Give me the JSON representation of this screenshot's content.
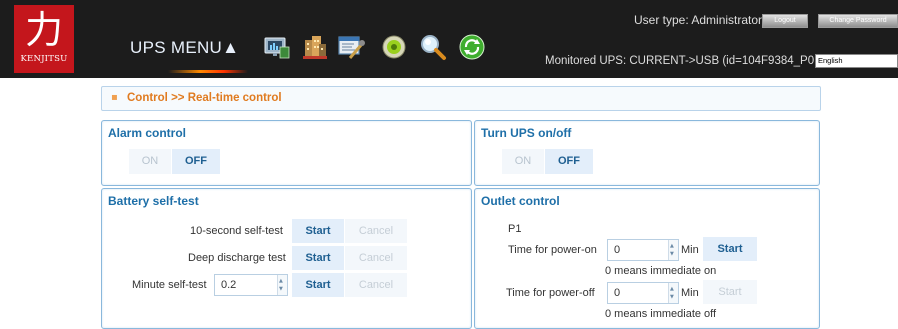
{
  "header": {
    "logo_glyph": "力",
    "logo_text": "KENJITSU",
    "menu_label": "UPS MENU▲",
    "user_type": "User type: Administrator",
    "logout_label": "Logout",
    "change_password_label": "Change Password",
    "monitored_ups": "Monitored UPS: CURRENT->USB (id=104F9384_P01)",
    "language": "English",
    "toolbar_icons": [
      "monitor-chart-icon",
      "buildings-icon",
      "settings-tools-icon",
      "power-disc-icon",
      "search-icon",
      "refresh-icon"
    ]
  },
  "breadcrumb": {
    "bullet": "▪",
    "text": "Control >> Real-time control"
  },
  "alarm_control": {
    "title": "Alarm control",
    "on_label": "ON",
    "off_label": "OFF"
  },
  "ups_onoff": {
    "title": "Turn UPS on/off",
    "on_label": "ON",
    "off_label": "OFF"
  },
  "battery_test": {
    "title": "Battery self-test",
    "rows": [
      {
        "label": "10-second self-test",
        "start": "Start",
        "cancel": "Cancel"
      },
      {
        "label": "Deep discharge test",
        "start": "Start",
        "cancel": "Cancel"
      },
      {
        "label": "Minute self-test",
        "value": "0.2",
        "start": "Start",
        "cancel": "Cancel"
      }
    ]
  },
  "outlet_control": {
    "title": "Outlet control",
    "outlet_name": "P1",
    "power_on": {
      "label": "Time for power-on",
      "value": "0",
      "unit": "Min",
      "start": "Start",
      "note": "0 means immediate on"
    },
    "power_off": {
      "label": "Time for power-off",
      "value": "0",
      "unit": "Min",
      "start": "Start",
      "note": "0 means immediate off"
    }
  },
  "colors": {
    "header_bg": "#1c1c1c",
    "logo_red": "#c4161c",
    "panel_border": "#8ab8dc",
    "title_blue": "#1e6fa8",
    "breadcrumb_orange": "#e07b20"
  }
}
